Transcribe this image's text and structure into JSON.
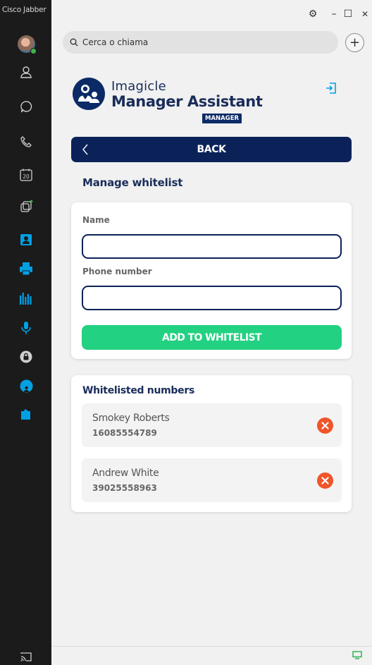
{
  "app": {
    "title": "Cisco Jabber"
  },
  "window_controls": {
    "settings": "⚙",
    "minimize": "–",
    "maximize": "☐",
    "close": "✕"
  },
  "search": {
    "placeholder": "Cerca o chiama"
  },
  "sidebar": {
    "items": [
      {
        "icon": "contacts-icon"
      },
      {
        "icon": "chat-icon"
      },
      {
        "icon": "phone-icon"
      },
      {
        "icon": "calendar-icon",
        "label": "20"
      },
      {
        "icon": "meetings-icon"
      },
      {
        "icon": "imagicle-contact-icon"
      },
      {
        "icon": "fax-icon"
      },
      {
        "icon": "analytics-icon"
      },
      {
        "icon": "recording-icon"
      },
      {
        "icon": "lock-icon"
      },
      {
        "icon": "manager-assistant-icon"
      },
      {
        "icon": "puzzle-icon"
      }
    ],
    "bottom_icon": "cast-icon"
  },
  "brand": {
    "line1": "Imagicle",
    "line2": "Manager Assistant",
    "badge": "MANAGER"
  },
  "back_label": "BACK",
  "page_title": "Manage whitelist",
  "form": {
    "name_label": "Name",
    "name_value": "",
    "phone_label": "Phone number",
    "phone_value": "",
    "add_label": "ADD TO WHITELIST"
  },
  "whitelist": {
    "title": "Whitelisted numbers",
    "items": [
      {
        "name": "Smokey Roberts",
        "number": "16085554789"
      },
      {
        "name": "Andrew White",
        "number": "39025558963"
      }
    ]
  },
  "colors": {
    "navy": "#0b2259",
    "green": "#22d181",
    "remove": "#f0542a",
    "accent": "#00a0e3"
  }
}
